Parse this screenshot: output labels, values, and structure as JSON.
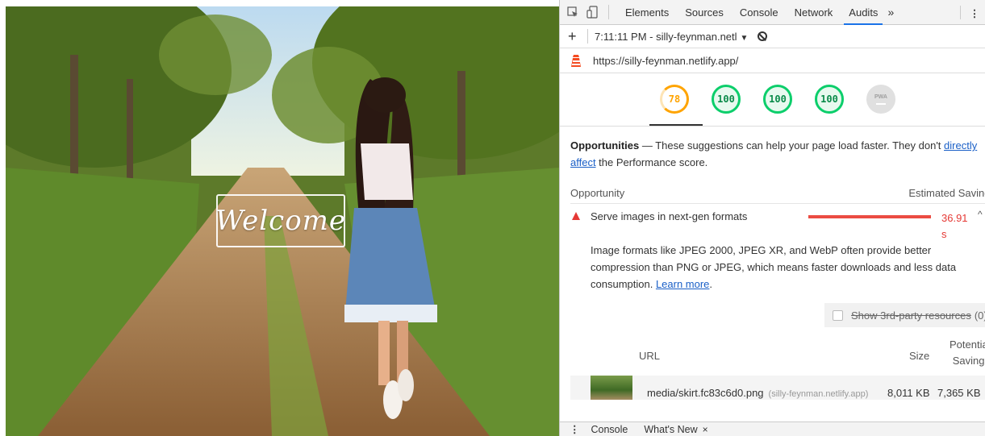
{
  "preview": {
    "welcome_text": "Welcome"
  },
  "devtools": {
    "tabs": [
      {
        "label": "Elements",
        "active": false
      },
      {
        "label": "Sources",
        "active": false
      },
      {
        "label": "Console",
        "active": false
      },
      {
        "label": "Network",
        "active": false
      },
      {
        "label": "Audits",
        "active": true
      }
    ],
    "overflow_label": "»",
    "run_label": "7:11:11 PM - silly-feynman.netl",
    "url": "https://silly-feynman.netlify.app/",
    "gauges": [
      {
        "score": "78",
        "status": "average",
        "color": "#ffa400"
      },
      {
        "score": "100",
        "status": "pass",
        "color": "#0cce6b"
      },
      {
        "score": "100",
        "status": "pass",
        "color": "#0cce6b"
      },
      {
        "score": "100",
        "status": "pass",
        "color": "#0cce6b"
      },
      {
        "score": "PWA",
        "status": "na",
        "color": "#e0e0e0"
      }
    ],
    "opportunities": {
      "title": "Opportunities",
      "dash": " — These suggestions can help your page load faster. They don't ",
      "link": "directly affect",
      "suffix": " the Performance score.",
      "col_opportunity": "Opportunity",
      "col_savings": "Estimated Savings",
      "item": {
        "title": "Serve images in next-gen formats",
        "savings": "36.91 s",
        "description": "Image formats like JPEG 2000, JPEG XR, and WebP often provide better compression than PNG or JPEG, which means faster downloads and less data consumption. ",
        "learn_more": "Learn more",
        "period": "."
      },
      "third_party_label": "Show 3rd-party resources",
      "third_party_count": "(0)",
      "table": {
        "col_url": "URL",
        "col_size": "Size",
        "col_potential": "Potential Savings",
        "rows": [
          {
            "url": "media/skirt.fc83c6d0.png",
            "host": "(silly-feynman.netlify.app)",
            "size": "8,011 KB",
            "potential": "7,365 KB"
          }
        ]
      }
    },
    "drawer": {
      "tab1": "Console",
      "tab2": "What's New",
      "close": "×"
    },
    "colors": {
      "accent": "#1a73e8",
      "fail": "#e53935",
      "pass": "#0cce6b",
      "average": "#ffa400"
    }
  }
}
